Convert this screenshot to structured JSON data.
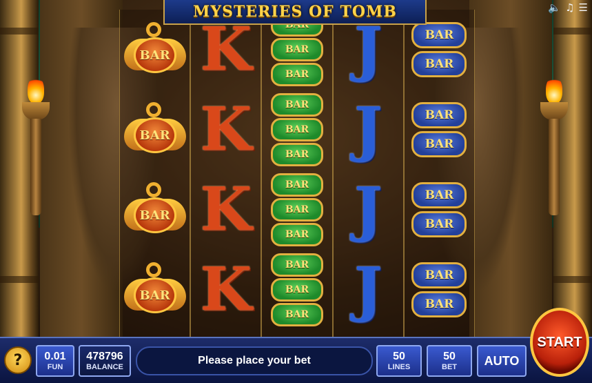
{
  "game": {
    "title": "MYSTERIES OF TOMB"
  },
  "sound_controls": {
    "icons": [
      "speaker-icon",
      "music-note-icon",
      "lines-icon"
    ]
  },
  "reels": [
    {
      "symbols": [
        "orange-bar",
        "orange-bar",
        "orange-bar",
        "orange-bar"
      ],
      "label": "BAR"
    },
    {
      "symbols": [
        "k",
        "k",
        "k",
        "k"
      ],
      "label": "K"
    },
    {
      "symbols": [
        "green-bar-stack",
        "green-bar-stack",
        "green-bar-stack",
        "green-bar-stack"
      ],
      "label": "BAR"
    },
    {
      "symbols": [
        "j",
        "j",
        "j",
        "j"
      ],
      "label": "J"
    },
    {
      "symbols": [
        "blue-double-bar",
        "blue-double-bar",
        "blue-double-bar",
        "blue-double-bar"
      ],
      "label": "BAR"
    }
  ],
  "bottom_bar": {
    "help_label": "?",
    "coin": {
      "value": "0.01",
      "label": "FUN"
    },
    "balance": {
      "value": "478796",
      "label": "BALANCE"
    },
    "message": "Please place your bet",
    "lines": {
      "value": "50",
      "label": "LINES"
    },
    "bet": {
      "value": "50",
      "label": "BET"
    },
    "auto_label": "AUTO",
    "start_label": "START"
  },
  "colors": {
    "accent_gold": "#e2b040",
    "panel_blue": "#1c2f8a",
    "start_red": "#b8200a"
  }
}
